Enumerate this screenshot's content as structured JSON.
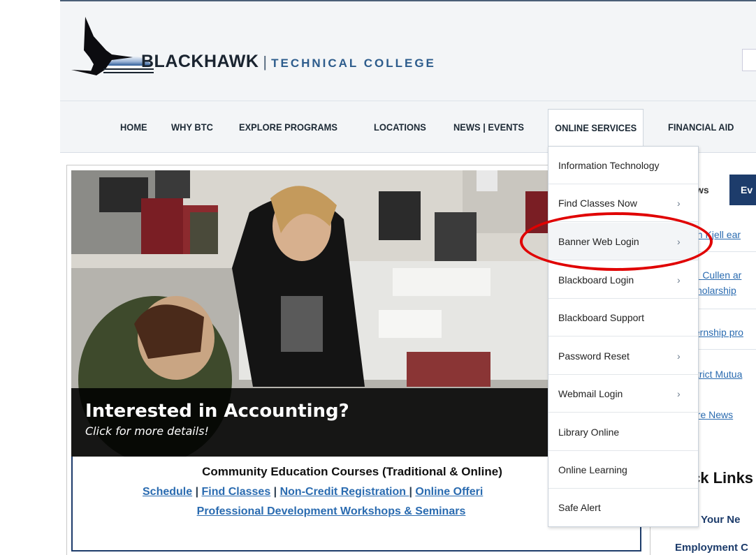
{
  "header": {
    "brand_main": "BLACKHAWK",
    "brand_sep": "|",
    "brand_sub": "TECHNICAL COLLEGE"
  },
  "nav": {
    "items": [
      {
        "label": "HOME"
      },
      {
        "label": "WHY BTC"
      },
      {
        "label": "EXPLORE PROGRAMS"
      },
      {
        "label": "LOCATIONS"
      },
      {
        "label": "NEWS | EVENTS"
      },
      {
        "label": "ONLINE SERVICES"
      },
      {
        "label": "FINANCIAL AID"
      }
    ]
  },
  "dropdown": {
    "items": [
      {
        "label": "Information Technology",
        "chevron": ""
      },
      {
        "label": "Find Classes Now",
        "chevron": "›"
      },
      {
        "label": "Banner Web Login",
        "chevron": "›"
      },
      {
        "label": "Blackboard Login",
        "chevron": "›"
      },
      {
        "label": "Blackboard Support",
        "chevron": ""
      },
      {
        "label": "Password Reset",
        "chevron": "›"
      },
      {
        "label": "Webmail Login",
        "chevron": "›"
      },
      {
        "label": "Library Online",
        "chevron": ""
      },
      {
        "label": "Online Learning",
        "chevron": ""
      },
      {
        "label": "Safe Alert",
        "chevron": ""
      }
    ]
  },
  "hero": {
    "title": "Interested in Accounting?",
    "subtitle": "Click for more details!"
  },
  "community": {
    "title": "Community Education Courses (Traditional & Online)",
    "link_schedule": "Schedule",
    "link_find": "Find Classes",
    "link_noncredit": "Non-Credit Registration ",
    "link_online": "Online Offeri",
    "sep": " | ",
    "link_pd": "Professional Development Workshops & Seminars"
  },
  "sidebar": {
    "tab_news": "ws",
    "tab_events": "Ev",
    "news": [
      "an Kjell ear",
      "P. Cullen ar",
      "cholarship",
      "ternship pro",
      "strict Mutua",
      "ore News"
    ],
    "quick_links_title": "ck Links",
    "quick_items": [
      "n Your Ne",
      "Employment C"
    ]
  },
  "colors": {
    "nav_text": "#1d2a36",
    "brand_blue": "#2d5c8c",
    "navy": "#1d3c6b",
    "link": "#2a6bb0",
    "annotation": "#e00000"
  },
  "icons": {
    "logo": "blackhawk-logo-icon",
    "chevron": "chevron-right-icon"
  }
}
